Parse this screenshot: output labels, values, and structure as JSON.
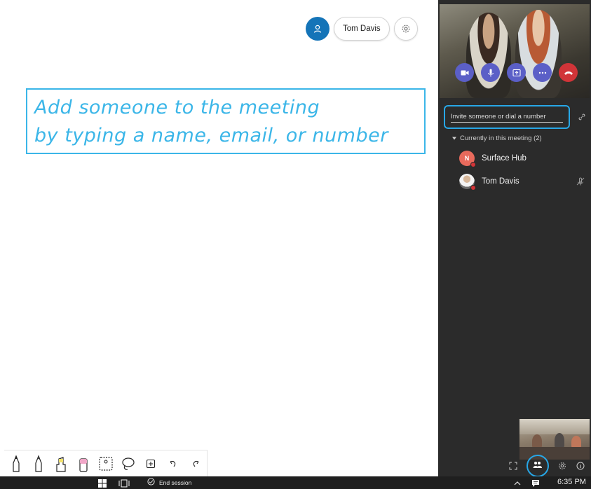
{
  "header": {
    "user_name": "Tom Davis",
    "icons": {
      "avatar": "person-icon",
      "settings": "gear-icon"
    }
  },
  "callout": {
    "line1": "Add someone to the meeting",
    "line2": "by typing a name, email, or number"
  },
  "ink_toolbar": {
    "tools": [
      "pen-black-icon",
      "pen-outline-icon",
      "highlighter-yellow-icon",
      "eraser-pink-icon",
      "ruler-icon",
      "lasso-icon",
      "insert-icon",
      "undo-icon",
      "redo-icon"
    ]
  },
  "meeting_pane": {
    "video_controls": [
      "camera-icon",
      "microphone-icon",
      "share-icon",
      "more-icon",
      "hang-up-icon"
    ],
    "invite_placeholder": "Invite someone or dial a number",
    "section_label": "Currently in this meeting (2)",
    "participants": [
      {
        "name": "Surface Hub",
        "initial": "N",
        "avatar_color": "#e86a5c"
      },
      {
        "name": "Tom Davis",
        "initial": "",
        "avatar_color": "#c9c3bc",
        "muted": true
      }
    ],
    "bottom_icons": [
      "fullscreen-icon",
      "people-icon",
      "gear-icon",
      "info-icon"
    ]
  },
  "taskbar": {
    "end_session_label": "End session",
    "clock": "6:35 PM"
  },
  "colors": {
    "accent_blue": "#27a7e7",
    "callout_blue": "#3bb6e8",
    "teams_purple": "#5b5fc7",
    "hangup_red": "#d13438",
    "pane_bg": "#2b2b2b"
  }
}
